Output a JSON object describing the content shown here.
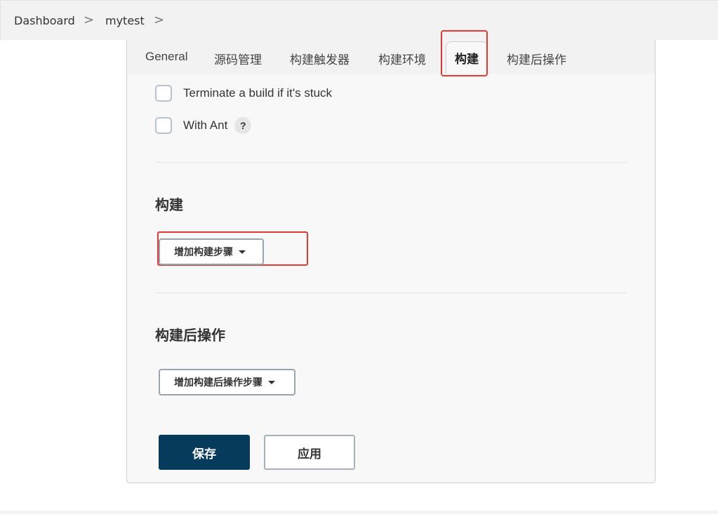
{
  "breadcrumb": {
    "items": [
      "Dashboard",
      "mytest"
    ],
    "separator": ">"
  },
  "tabs": [
    "General",
    "源码管理",
    "构建触发器",
    "构建环境",
    "构建",
    "构建后操作"
  ],
  "active_tab": "构建",
  "options": [
    {
      "label": "Terminate a build if it's stuck",
      "checked": false
    },
    {
      "label": "With Ant",
      "checked": false,
      "help": "?"
    }
  ],
  "build_section": {
    "title": "构建",
    "add_step_label": "增加构建步骤"
  },
  "post_build_section": {
    "title": "构建后操作",
    "add_step_label": "增加构建后操作步骤"
  },
  "buttons": {
    "save": "保存",
    "apply": "应用"
  },
  "colors": {
    "primary_button": "#073b5c",
    "highlight": "#e53935"
  }
}
